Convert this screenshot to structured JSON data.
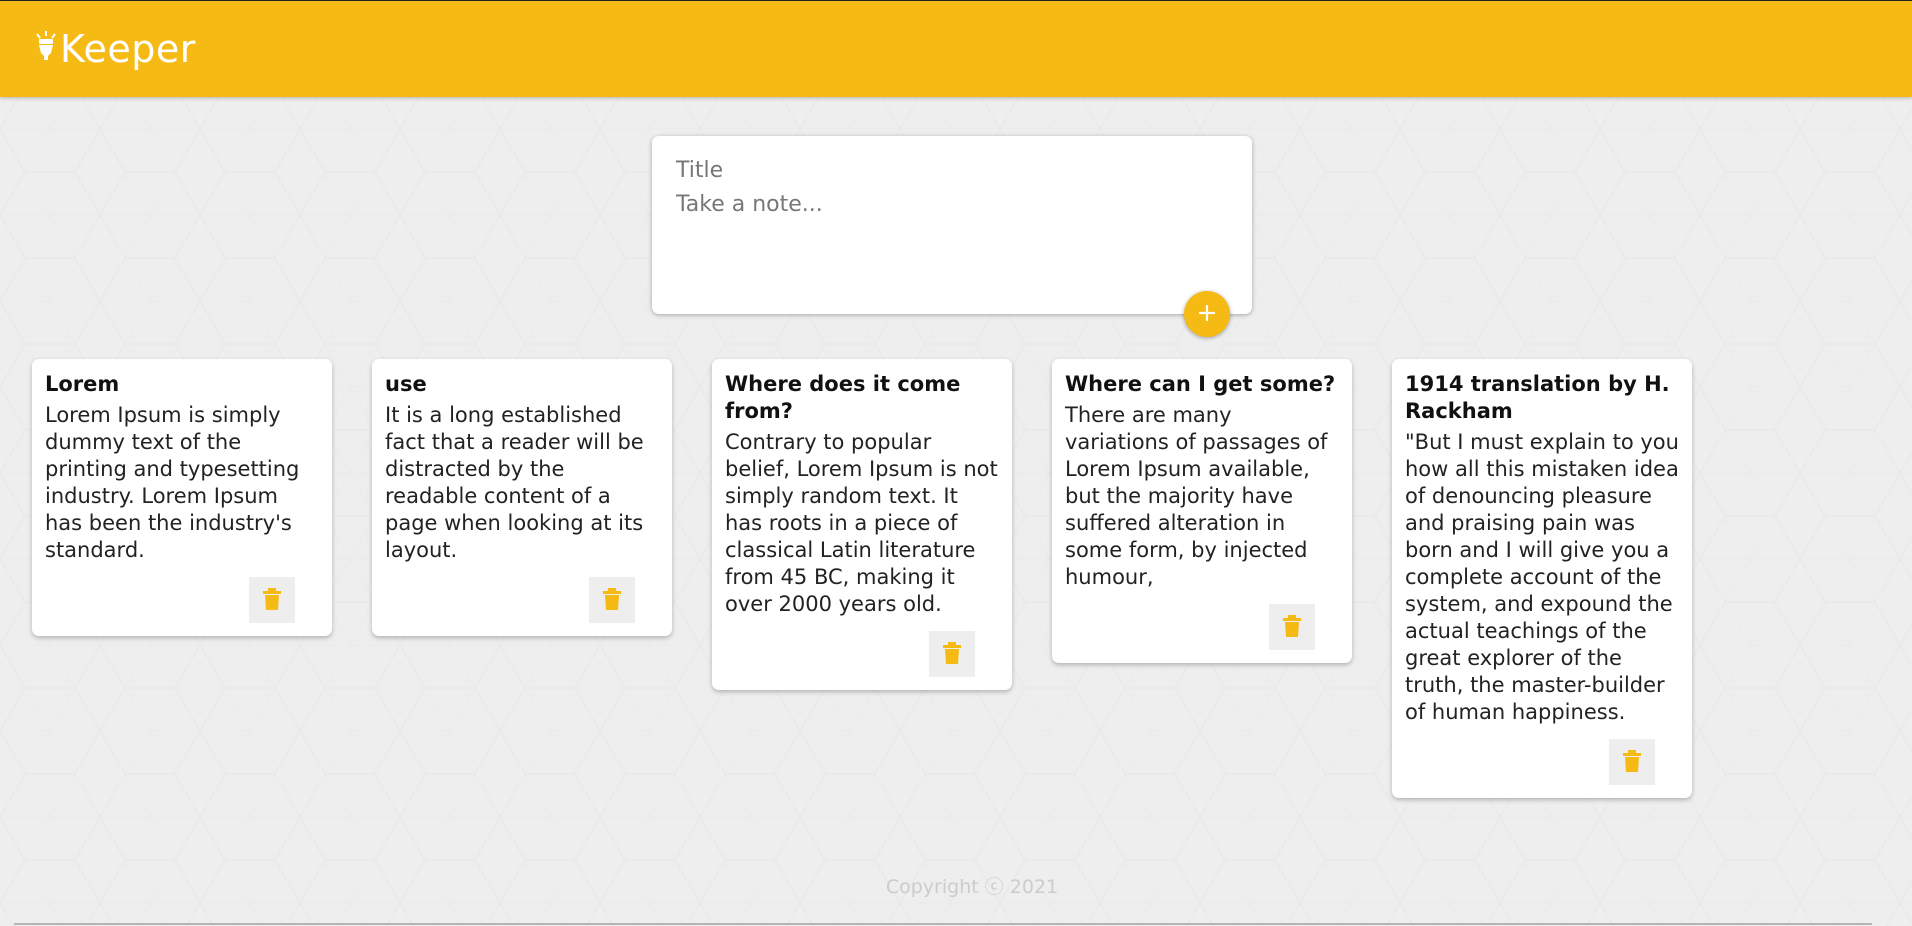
{
  "app": {
    "brand_name": "Keeper",
    "brand_icon": "lightbulb-icon",
    "accent_color": "#f5ba13"
  },
  "create_note": {
    "title_placeholder": "Title",
    "content_placeholder": "Take a note...",
    "add_icon": "plus-icon"
  },
  "notes": [
    {
      "title": "Lorem",
      "content": "Lorem Ipsum is simply dummy text of the printing and typesetting industry. Lorem Ipsum has been the industry's standard."
    },
    {
      "title": "use",
      "content": "It is a long established fact that a reader will be distracted by the readable content of a page when looking at its layout."
    },
    {
      "title": "Where does it come from?",
      "content": "Contrary to popular belief, Lorem Ipsum is not simply random text. It has roots in a piece of classical Latin literature from 45 BC, making it over 2000 years old."
    },
    {
      "title": "Where can I get some?",
      "content": "There are many variations of passages of Lorem Ipsum available, but the majority have suffered alteration in some form, by injected humour,"
    },
    {
      "title": "1914 translation by H. Rackham",
      "content": "\"But I must explain to you how all this mistaken idea of denouncing pleasure and praising pain was born and I will give you a complete account of the system, and expound the actual teachings of the great explorer of the truth, the master-builder of human happiness."
    }
  ],
  "delete_icon": "trash-icon",
  "footer": {
    "copyright": "Copyright ⓒ 2021"
  }
}
